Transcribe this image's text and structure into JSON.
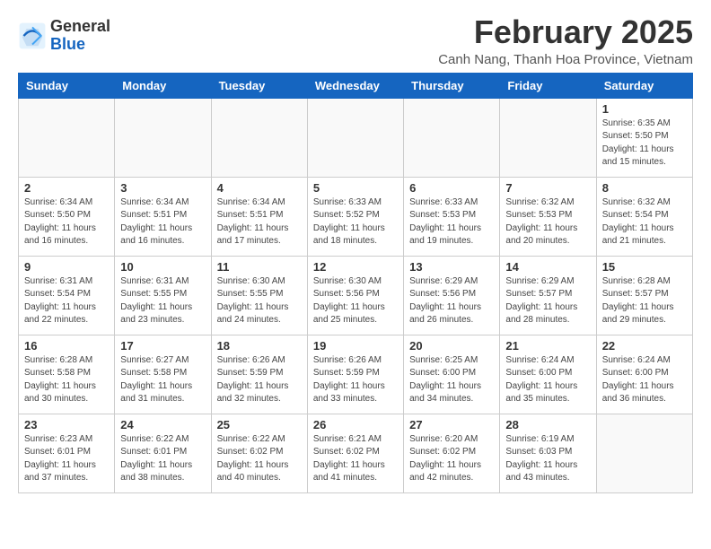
{
  "logo": {
    "general": "General",
    "blue": "Blue"
  },
  "header": {
    "month": "February 2025",
    "location": "Canh Nang, Thanh Hoa Province, Vietnam"
  },
  "weekdays": [
    "Sunday",
    "Monday",
    "Tuesday",
    "Wednesday",
    "Thursday",
    "Friday",
    "Saturday"
  ],
  "weeks": [
    [
      {
        "day": "",
        "sunrise": "",
        "sunset": "",
        "daylight": ""
      },
      {
        "day": "",
        "sunrise": "",
        "sunset": "",
        "daylight": ""
      },
      {
        "day": "",
        "sunrise": "",
        "sunset": "",
        "daylight": ""
      },
      {
        "day": "",
        "sunrise": "",
        "sunset": "",
        "daylight": ""
      },
      {
        "day": "",
        "sunrise": "",
        "sunset": "",
        "daylight": ""
      },
      {
        "day": "",
        "sunrise": "",
        "sunset": "",
        "daylight": ""
      },
      {
        "day": "1",
        "sunrise": "Sunrise: 6:35 AM",
        "sunset": "Sunset: 5:50 PM",
        "daylight": "Daylight: 11 hours and 15 minutes."
      }
    ],
    [
      {
        "day": "2",
        "sunrise": "Sunrise: 6:34 AM",
        "sunset": "Sunset: 5:50 PM",
        "daylight": "Daylight: 11 hours and 16 minutes."
      },
      {
        "day": "3",
        "sunrise": "Sunrise: 6:34 AM",
        "sunset": "Sunset: 5:51 PM",
        "daylight": "Daylight: 11 hours and 16 minutes."
      },
      {
        "day": "4",
        "sunrise": "Sunrise: 6:34 AM",
        "sunset": "Sunset: 5:51 PM",
        "daylight": "Daylight: 11 hours and 17 minutes."
      },
      {
        "day": "5",
        "sunrise": "Sunrise: 6:33 AM",
        "sunset": "Sunset: 5:52 PM",
        "daylight": "Daylight: 11 hours and 18 minutes."
      },
      {
        "day": "6",
        "sunrise": "Sunrise: 6:33 AM",
        "sunset": "Sunset: 5:53 PM",
        "daylight": "Daylight: 11 hours and 19 minutes."
      },
      {
        "day": "7",
        "sunrise": "Sunrise: 6:32 AM",
        "sunset": "Sunset: 5:53 PM",
        "daylight": "Daylight: 11 hours and 20 minutes."
      },
      {
        "day": "8",
        "sunrise": "Sunrise: 6:32 AM",
        "sunset": "Sunset: 5:54 PM",
        "daylight": "Daylight: 11 hours and 21 minutes."
      }
    ],
    [
      {
        "day": "9",
        "sunrise": "Sunrise: 6:31 AM",
        "sunset": "Sunset: 5:54 PM",
        "daylight": "Daylight: 11 hours and 22 minutes."
      },
      {
        "day": "10",
        "sunrise": "Sunrise: 6:31 AM",
        "sunset": "Sunset: 5:55 PM",
        "daylight": "Daylight: 11 hours and 23 minutes."
      },
      {
        "day": "11",
        "sunrise": "Sunrise: 6:30 AM",
        "sunset": "Sunset: 5:55 PM",
        "daylight": "Daylight: 11 hours and 24 minutes."
      },
      {
        "day": "12",
        "sunrise": "Sunrise: 6:30 AM",
        "sunset": "Sunset: 5:56 PM",
        "daylight": "Daylight: 11 hours and 25 minutes."
      },
      {
        "day": "13",
        "sunrise": "Sunrise: 6:29 AM",
        "sunset": "Sunset: 5:56 PM",
        "daylight": "Daylight: 11 hours and 26 minutes."
      },
      {
        "day": "14",
        "sunrise": "Sunrise: 6:29 AM",
        "sunset": "Sunset: 5:57 PM",
        "daylight": "Daylight: 11 hours and 28 minutes."
      },
      {
        "day": "15",
        "sunrise": "Sunrise: 6:28 AM",
        "sunset": "Sunset: 5:57 PM",
        "daylight": "Daylight: 11 hours and 29 minutes."
      }
    ],
    [
      {
        "day": "16",
        "sunrise": "Sunrise: 6:28 AM",
        "sunset": "Sunset: 5:58 PM",
        "daylight": "Daylight: 11 hours and 30 minutes."
      },
      {
        "day": "17",
        "sunrise": "Sunrise: 6:27 AM",
        "sunset": "Sunset: 5:58 PM",
        "daylight": "Daylight: 11 hours and 31 minutes."
      },
      {
        "day": "18",
        "sunrise": "Sunrise: 6:26 AM",
        "sunset": "Sunset: 5:59 PM",
        "daylight": "Daylight: 11 hours and 32 minutes."
      },
      {
        "day": "19",
        "sunrise": "Sunrise: 6:26 AM",
        "sunset": "Sunset: 5:59 PM",
        "daylight": "Daylight: 11 hours and 33 minutes."
      },
      {
        "day": "20",
        "sunrise": "Sunrise: 6:25 AM",
        "sunset": "Sunset: 6:00 PM",
        "daylight": "Daylight: 11 hours and 34 minutes."
      },
      {
        "day": "21",
        "sunrise": "Sunrise: 6:24 AM",
        "sunset": "Sunset: 6:00 PM",
        "daylight": "Daylight: 11 hours and 35 minutes."
      },
      {
        "day": "22",
        "sunrise": "Sunrise: 6:24 AM",
        "sunset": "Sunset: 6:00 PM",
        "daylight": "Daylight: 11 hours and 36 minutes."
      }
    ],
    [
      {
        "day": "23",
        "sunrise": "Sunrise: 6:23 AM",
        "sunset": "Sunset: 6:01 PM",
        "daylight": "Daylight: 11 hours and 37 minutes."
      },
      {
        "day": "24",
        "sunrise": "Sunrise: 6:22 AM",
        "sunset": "Sunset: 6:01 PM",
        "daylight": "Daylight: 11 hours and 38 minutes."
      },
      {
        "day": "25",
        "sunrise": "Sunrise: 6:22 AM",
        "sunset": "Sunset: 6:02 PM",
        "daylight": "Daylight: 11 hours and 40 minutes."
      },
      {
        "day": "26",
        "sunrise": "Sunrise: 6:21 AM",
        "sunset": "Sunset: 6:02 PM",
        "daylight": "Daylight: 11 hours and 41 minutes."
      },
      {
        "day": "27",
        "sunrise": "Sunrise: 6:20 AM",
        "sunset": "Sunset: 6:02 PM",
        "daylight": "Daylight: 11 hours and 42 minutes."
      },
      {
        "day": "28",
        "sunrise": "Sunrise: 6:19 AM",
        "sunset": "Sunset: 6:03 PM",
        "daylight": "Daylight: 11 hours and 43 minutes."
      },
      {
        "day": "",
        "sunrise": "",
        "sunset": "",
        "daylight": ""
      }
    ]
  ]
}
